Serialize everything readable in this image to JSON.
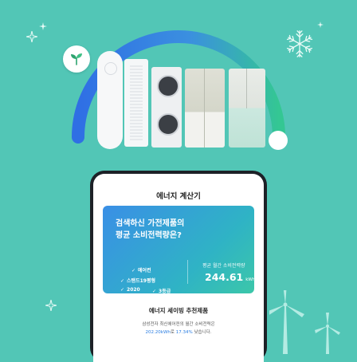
{
  "colors": {
    "background": "#52c6b6",
    "arc_start": "#2f6fe4",
    "arc_end": "#34c793",
    "accent_blue": "#2a7de1"
  },
  "icons": [
    "leaf-icon",
    "snowflake-icon",
    "sparkle-icon",
    "wind-turbine-icon",
    "check-icon"
  ],
  "calculator": {
    "title": "에너지 계산기",
    "question_line1": "검색하신 가전제품의",
    "question_line2": "평균 소비전력량은?",
    "specs": [
      "에어컨",
      "스탠드19평형",
      "2020",
      "3등급"
    ],
    "average_label": "평균 월간 소비전력량",
    "average_value": "244.61",
    "average_unit": "kWh",
    "recommend_title": "에너지 세이빙 추천제품",
    "recommend_line1": "삼성전자 최신에어컨의 월간 소비전력은",
    "recommend_value": "202.20kWh",
    "recommend_mid": "로",
    "recommend_percent": "17.34%",
    "recommend_end": " 낮습니다."
  }
}
